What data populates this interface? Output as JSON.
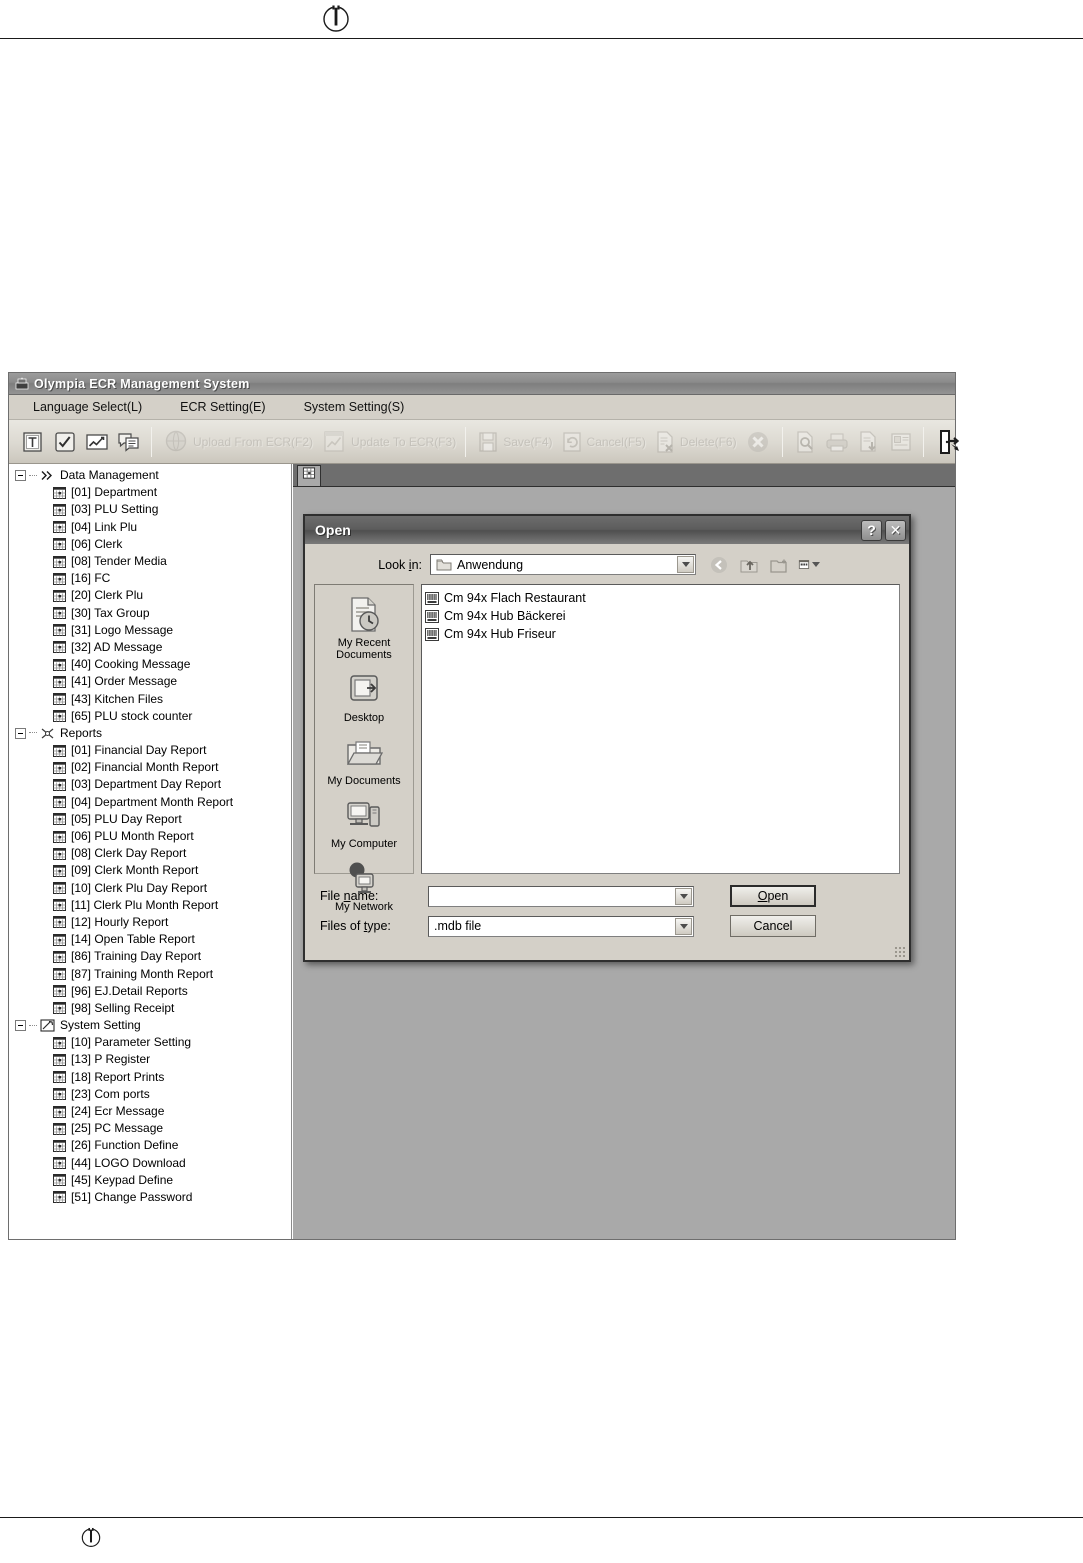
{
  "page": {
    "logo_icon": "olympia-circle-logo"
  },
  "app": {
    "title": "Olympia ECR Management System",
    "title_icon": "ecr-register-icon",
    "menu": [
      {
        "label": "Language Select(L)",
        "name": "menu-language-select"
      },
      {
        "label": "ECR Setting(E)",
        "name": "menu-ecr-setting"
      },
      {
        "label": "System Setting(S)",
        "name": "menu-system-setting"
      }
    ],
    "toolbar": {
      "groups": [
        {
          "name": "data-group",
          "buttons": [
            {
              "label": "",
              "icon": "department-icon",
              "name": "toolbar-department",
              "enabled": true
            },
            {
              "label": "",
              "icon": "checklist-icon",
              "name": "toolbar-checklist",
              "enabled": true
            },
            {
              "label": "",
              "icon": "chart-icon",
              "name": "toolbar-chart",
              "enabled": true
            },
            {
              "label": "",
              "icon": "message-list-icon",
              "name": "toolbar-messages",
              "enabled": true
            }
          ]
        },
        {
          "name": "transfer-group",
          "buttons": [
            {
              "label": "Upload From ECR(F2)",
              "icon": "upload-globe-icon",
              "name": "toolbar-upload-from-ecr",
              "enabled": false
            },
            {
              "label": "Update To ECR(F3)",
              "icon": "update-chart-icon",
              "name": "toolbar-update-to-ecr",
              "enabled": false
            }
          ]
        },
        {
          "name": "edit-group",
          "buttons": [
            {
              "label": "Save(F4)",
              "icon": "floppy-save-icon",
              "name": "toolbar-save",
              "enabled": false
            },
            {
              "label": "Cancel(F5)",
              "icon": "undo-cancel-icon",
              "name": "toolbar-cancel",
              "enabled": false
            },
            {
              "label": "Delete(F6)",
              "icon": "delete-document-icon",
              "name": "toolbar-delete",
              "enabled": false
            },
            {
              "label": "",
              "icon": "close-circle-icon",
              "name": "toolbar-close",
              "enabled": false
            }
          ]
        },
        {
          "name": "print-group",
          "buttons": [
            {
              "label": "",
              "icon": "print-preview-icon",
              "name": "toolbar-print-preview",
              "enabled": false
            },
            {
              "label": "",
              "icon": "printer-icon",
              "name": "toolbar-print",
              "enabled": false
            },
            {
              "label": "",
              "icon": "export-icon",
              "name": "toolbar-export",
              "enabled": false
            },
            {
              "label": "",
              "icon": "page-setup-icon",
              "name": "toolbar-page-setup",
              "enabled": false
            }
          ]
        },
        {
          "name": "exit-group",
          "buttons": [
            {
              "label": "",
              "icon": "exit-door-icon",
              "name": "toolbar-exit",
              "enabled": true
            }
          ]
        }
      ]
    },
    "tree": [
      {
        "label": "Data Management",
        "icon": "chevron-double-right-icon",
        "expanded": true,
        "children": [
          "[01] Department",
          "[03] PLU Setting",
          "[04] Link Plu",
          "[06] Clerk",
          "[08] Tender Media",
          "[16] FC",
          "[20] Clerk Plu",
          "[30] Tax Group",
          "[31] Logo Message",
          "[32] AD Message",
          "[40] Cooking Message",
          "[41] Order Message",
          "[43] Kitchen Files",
          "[65] PLU stock counter"
        ]
      },
      {
        "label": "Reports",
        "icon": "reports-icon",
        "expanded": true,
        "children": [
          "[01] Financial Day Report",
          "[02] Financial Month Report",
          "[03] Department Day Report",
          "[04] Department Month Report",
          "[05] PLU Day Report",
          "[06] PLU Month Report",
          "[08] Clerk Day Report",
          "[09] Clerk Month Report",
          "[10] Clerk Plu Day Report",
          "[11] Clerk Plu Month Report",
          "[12] Hourly Report",
          "[14] Open Table Report",
          "[86] Training Day Report",
          "[87] Training Month Report",
          "[96] EJ.Detail Reports",
          "[98] Selling Receipt"
        ]
      },
      {
        "label": "System Setting",
        "icon": "system-setting-icon",
        "expanded": true,
        "children": [
          "[10] Parameter Setting",
          "[13] P Register",
          "[18] Report Prints",
          "[23] Com ports",
          "[24] Ecr Message",
          "[25] PC Message",
          "[26] Function Define",
          "[44] LOGO Download",
          "[45] Keypad Define",
          "[51] Change Password"
        ]
      }
    ],
    "content_tab_icon": "grid-table-icon"
  },
  "dialog": {
    "title": "Open",
    "help_label": "?",
    "close_label": "✕",
    "look_in": {
      "label": "Look in:",
      "label_prefix": "Look ",
      "label_accel": "i",
      "label_suffix": "n:",
      "value": "Anwendung",
      "icon": "folder-icon"
    },
    "nav_buttons": [
      {
        "name": "back-button",
        "icon": "back-arrow-icon"
      },
      {
        "name": "up-one-level-button",
        "icon": "up-folder-icon"
      },
      {
        "name": "new-folder-button",
        "icon": "new-folder-icon"
      },
      {
        "name": "views-button",
        "icon": "views-grid-icon"
      }
    ],
    "places": [
      {
        "label": "My Recent\nDocuments",
        "line1": "My Recent",
        "line2": "Documents",
        "icon": "recent-documents-icon",
        "name": "place-my-recent-documents"
      },
      {
        "label": "Desktop",
        "line1": "Desktop",
        "line2": "",
        "icon": "desktop-icon",
        "name": "place-desktop"
      },
      {
        "label": "My Documents",
        "line1": "My Documents",
        "line2": "",
        "icon": "my-documents-icon",
        "name": "place-my-documents"
      },
      {
        "label": "My Computer",
        "line1": "My Computer",
        "line2": "",
        "icon": "my-computer-icon",
        "name": "place-my-computer"
      },
      {
        "label": "My Network",
        "line1": "My Network",
        "line2": "",
        "icon": "my-network-icon",
        "name": "place-my-network"
      }
    ],
    "files": [
      {
        "name": "Cm 94x Flach Restaurant",
        "icon": "mdb-file-icon"
      },
      {
        "name": "Cm 94x Hub Bäckerei",
        "icon": "mdb-file-icon"
      },
      {
        "name": "Cm 94x Hub Friseur",
        "icon": "mdb-file-icon"
      }
    ],
    "file_name": {
      "label": "File name:",
      "label_prefix": "File ",
      "label_accel": "n",
      "label_suffix": "ame:",
      "value": "",
      "placeholder": ""
    },
    "files_of_type": {
      "label": "Files of type:",
      "label_prefix": "Files of ",
      "label_accel": "t",
      "label_suffix": "ype:",
      "value": ".mdb file",
      "options": [
        ".mdb file"
      ]
    },
    "open_button": {
      "prefix": "",
      "accel": "O",
      "suffix": "pen",
      "label": "Open"
    },
    "cancel_button": {
      "label": "Cancel"
    }
  },
  "colors": {
    "window_face": "#d4d0c8",
    "title_bar": "#8a8a8a",
    "content_bg": "#a9a9a9",
    "tree_bg": "#ffffff",
    "dialog_title": "#5c5c5c"
  }
}
